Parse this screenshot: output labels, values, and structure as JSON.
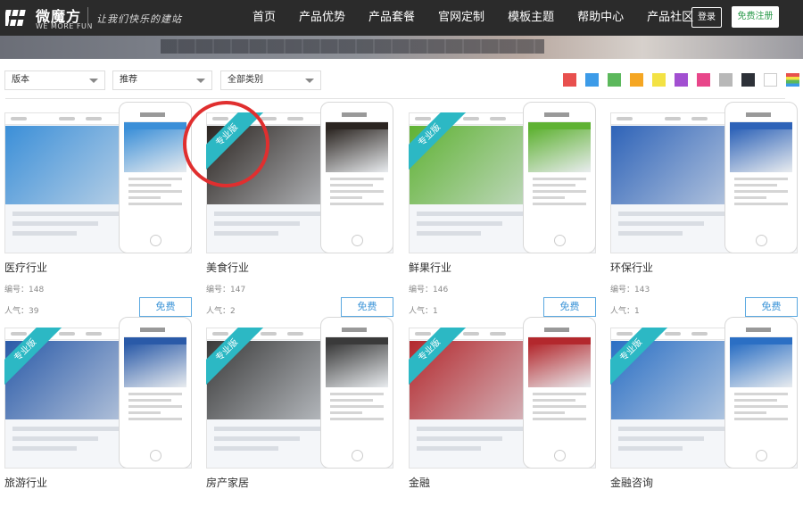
{
  "header": {
    "brand_name": "微魔方",
    "brand_sub": "WE MORE FUN",
    "slogan": "让我们快乐的建站",
    "nav": [
      "首页",
      "产品优势",
      "产品套餐",
      "官网定制",
      "模板主题",
      "帮助中心",
      "产品社区"
    ],
    "login_label": "登录",
    "register_label": "免费注册"
  },
  "filters": {
    "version": "版本",
    "sort": "推荐",
    "category": "全部类别"
  },
  "color_swatches": [
    "#e8504e",
    "#3c9be8",
    "#5cb85c",
    "#f5a623",
    "#f3e244",
    "#a24fd1",
    "#e8468a",
    "#b8b8b8",
    "#2d3138",
    "#ffffff",
    "rainbow"
  ],
  "ribbon_label": "专业版",
  "templates": [
    {
      "title": "医疗行业",
      "number": "编号：148",
      "popularity": "人气：39",
      "price": "免费",
      "pro": false,
      "theme": "#3b8fd8"
    },
    {
      "title": "美食行业",
      "number": "编号：147",
      "popularity": "人气：2",
      "price": "免费",
      "pro": true,
      "theme": "#2b2521"
    },
    {
      "title": "鲜果行业",
      "number": "编号：146",
      "popularity": "人气：1",
      "price": "免费",
      "pro": true,
      "theme": "#5fb233"
    },
    {
      "title": "环保行业",
      "number": "编号：143",
      "popularity": "人气：1",
      "price": "免费",
      "pro": false,
      "theme": "#2e63b8"
    },
    {
      "title": "旅游行业",
      "pro": true,
      "theme": "#2a5aa8"
    },
    {
      "title": "房产家居",
      "pro": true,
      "theme": "#3a3a3a"
    },
    {
      "title": "金融",
      "pro": true,
      "theme": "#b3282d"
    },
    {
      "title": "金融咨询",
      "pro": true,
      "theme": "#2b6fc4"
    }
  ]
}
